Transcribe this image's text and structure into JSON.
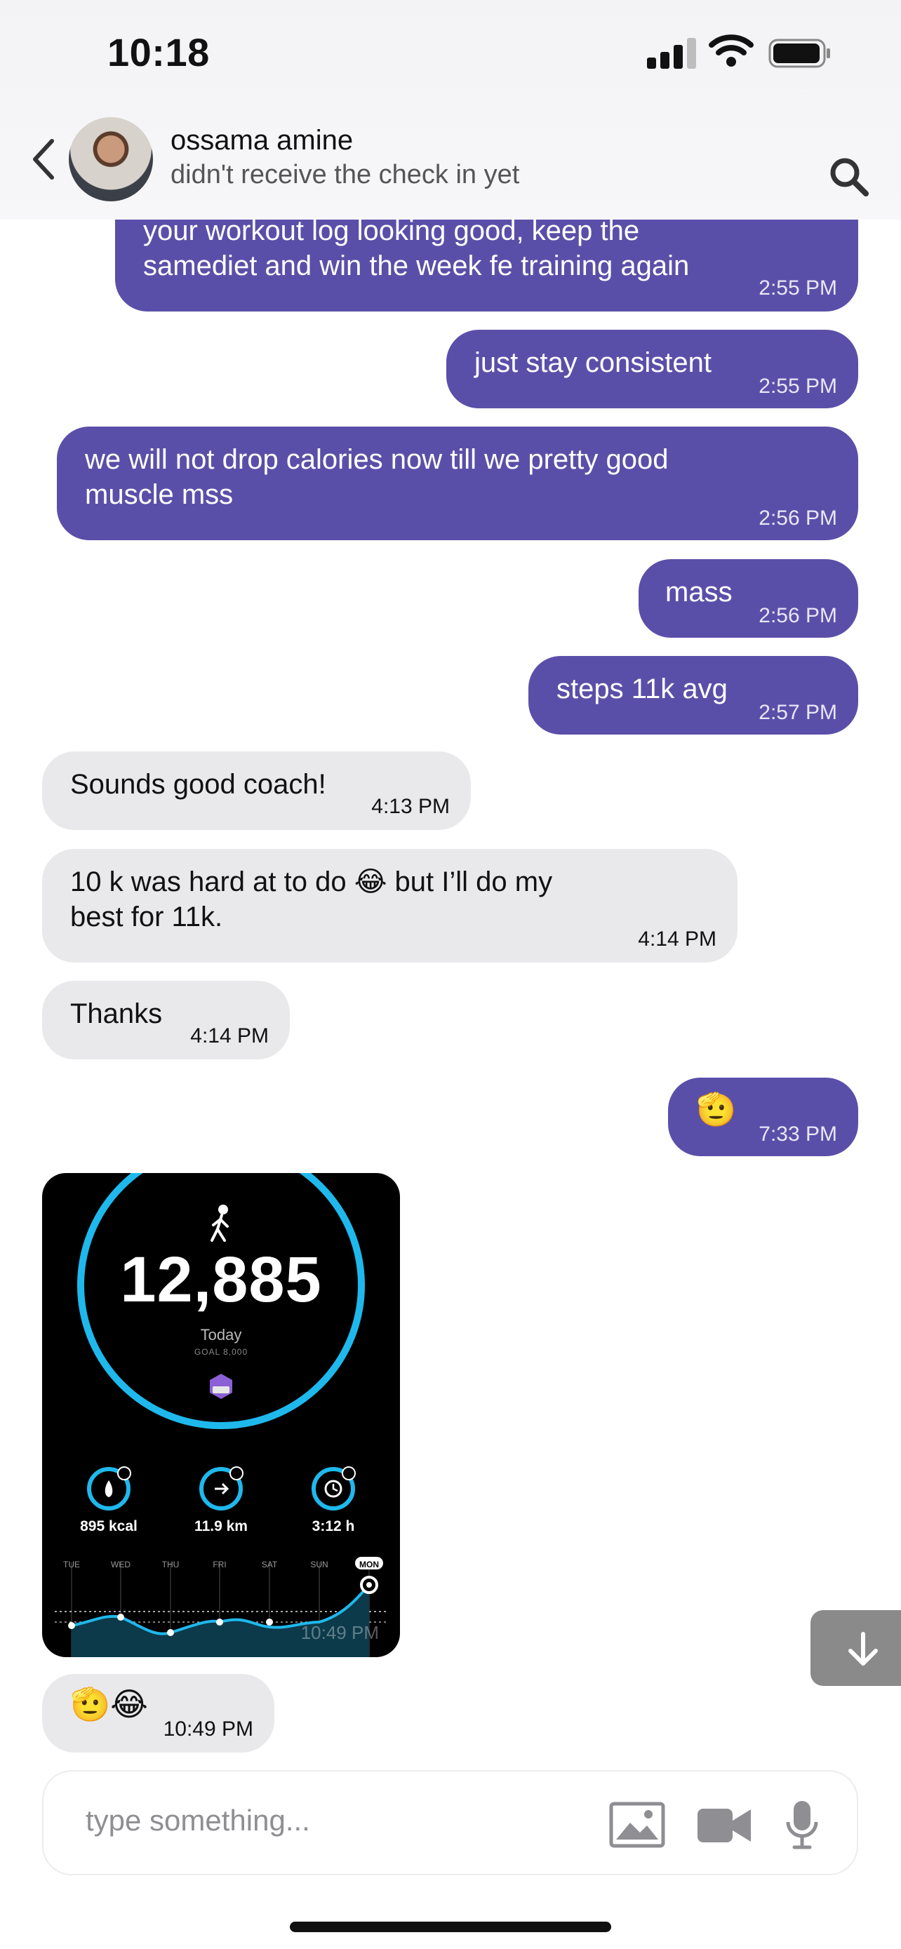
{
  "status_bar": {
    "time": "10:18"
  },
  "header": {
    "contact_name": "ossama amine",
    "subtitle": "didn't receive the check in yet"
  },
  "messages": [
    {
      "dir": "out",
      "text": "your workout log looking good, keep the\nsamediet and win the week fe training again",
      "time": "2:55 PM"
    },
    {
      "dir": "out",
      "text": "just stay consistent",
      "time": "2:55 PM"
    },
    {
      "dir": "out",
      "text": "we will not drop calories now till we pretty good\nmuscle mss",
      "time": "2:56 PM"
    },
    {
      "dir": "out",
      "text": "mass",
      "time": "2:56 PM"
    },
    {
      "dir": "out",
      "text": "steps 11k avg",
      "time": "2:57 PM"
    },
    {
      "dir": "in",
      "text": "Sounds good coach!",
      "time": "4:13 PM"
    },
    {
      "dir": "in",
      "text": "10 k was hard at to do  😂 but I’ll do my\nbest for 11k.",
      "time": "4:14 PM"
    },
    {
      "dir": "in",
      "text": "Thanks",
      "time": "4:14 PM"
    },
    {
      "dir": "out",
      "text": "🫡",
      "time": "7:33 PM"
    },
    {
      "dir": "in",
      "text": "🫡😂",
      "time": "10:49 PM"
    }
  ],
  "activity_card": {
    "steps": "12,885",
    "period": "Today",
    "goal": "GOAL 8,000",
    "stats": [
      {
        "value": "895 kcal",
        "icon": "flame-icon"
      },
      {
        "value": "11.9 km",
        "icon": "arrow-icon"
      },
      {
        "value": "3:12 h",
        "icon": "clock-icon"
      }
    ],
    "days": [
      "TUE",
      "WED",
      "THU",
      "FRI",
      "SAT",
      "SUN",
      "MON"
    ],
    "overlay_time": "10:49 PM",
    "accent": "#1fb8ec"
  },
  "composer": {
    "placeholder": "type something..."
  },
  "colors": {
    "outgoing": "#5a4fa8",
    "incoming": "#e9e9eb"
  }
}
